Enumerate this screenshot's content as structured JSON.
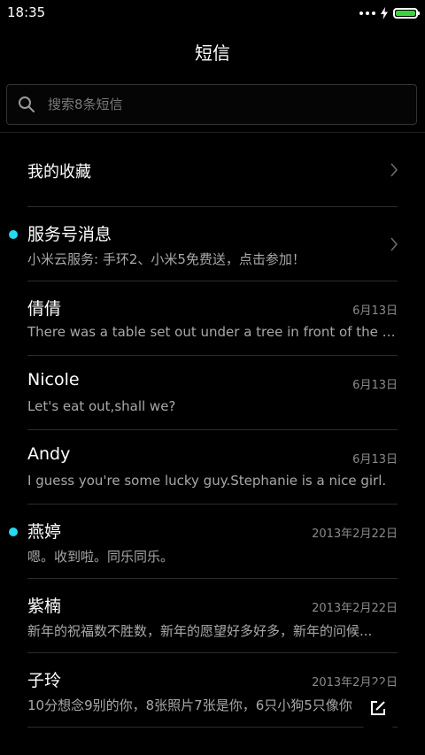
{
  "status_bar": {
    "time": "18:35",
    "battery_level": 1.0,
    "battery_color": "#3ed13e"
  },
  "header": {
    "title": "短信"
  },
  "search": {
    "placeholder": "搜索8条短信",
    "icon": "search-icon"
  },
  "favorites": {
    "label": "我的收藏",
    "icon": "chevron-right-icon"
  },
  "accent_colors": {
    "unread_dot": "#26d8f0"
  },
  "conversations": [
    {
      "name": "服务号消息",
      "preview": "小米云服务: 手环2、小米5免费送，点击参加！",
      "date": "",
      "unread": true,
      "chevron": true
    },
    {
      "name": "倩倩",
      "preview": "There was a table set out under a tree in front of the ho...",
      "date": "6月13日",
      "unread": false,
      "chevron": false
    },
    {
      "name": "Nicole",
      "preview": "Let's eat out,shall we?",
      "date": "6月13日",
      "unread": false,
      "chevron": false
    },
    {
      "name": "Andy",
      "preview": "I guess you're some lucky guy.Stephanie is a nice girl.",
      "date": "6月13日",
      "unread": false,
      "chevron": false
    },
    {
      "name": "燕婷",
      "preview": "嗯。收到啦。同乐同乐。",
      "date": "2013年2月22日",
      "unread": true,
      "chevron": false
    },
    {
      "name": "紫楠",
      "preview": "新年的祝福数不胜数，新年的愿望好多好多，新年的问候...",
      "date": "2013年2月22日",
      "unread": false,
      "chevron": false
    },
    {
      "name": "子玲",
      "preview": "10分想念9别的你，8张照片7张是你，6只小狗5只像你",
      "date": "2013年2月22日",
      "unread": false,
      "chevron": false
    }
  ],
  "compose": {
    "icon": "compose-icon"
  }
}
